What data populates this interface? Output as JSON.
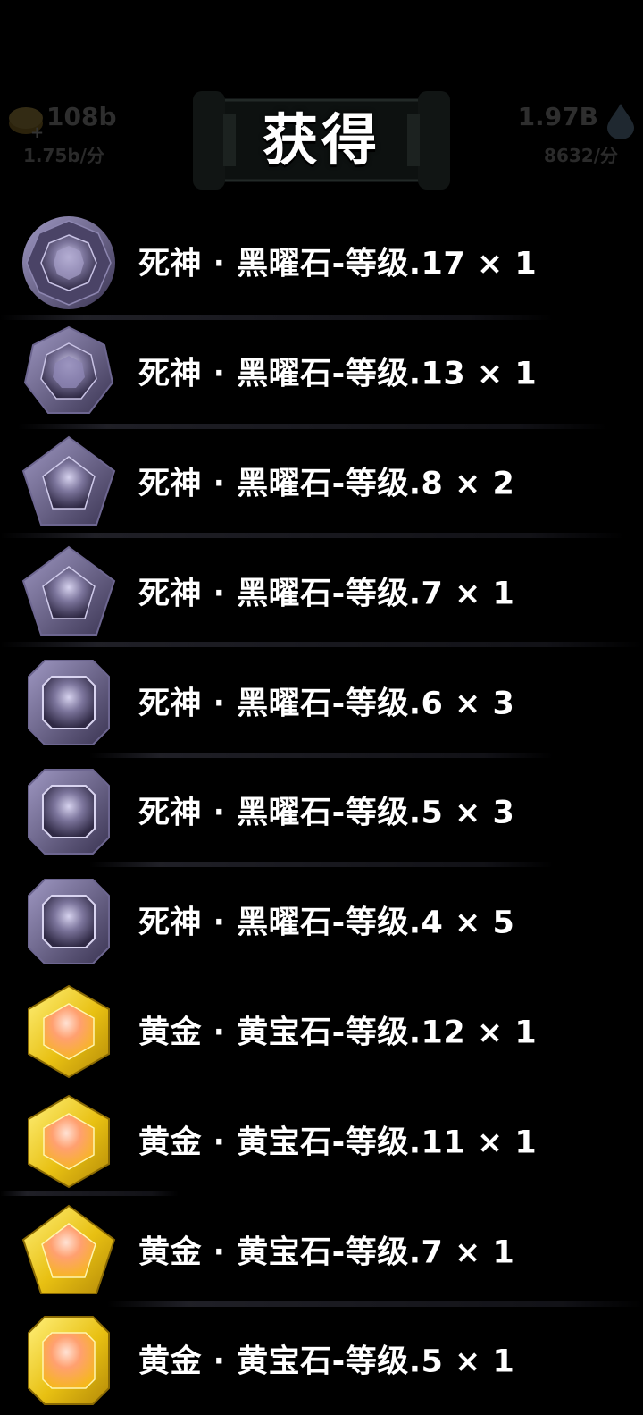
{
  "header": {
    "title": "获得",
    "left_resource": {
      "amount": "108b",
      "plus": "+",
      "rate": "1.75b/分",
      "icon": "gold-coin-icon"
    },
    "right_resource": {
      "amount": "1.97B",
      "rate": "8632/分",
      "icon": "water-drop-icon"
    }
  },
  "items": [
    {
      "name": "死神 · 黑曜石-等级.17 × 1",
      "gem": "obsidian-round-gem-icon"
    },
    {
      "name": "死神 · 黑曜石-等级.13 × 1",
      "gem": "obsidian-heptagon-gem-icon"
    },
    {
      "name": "死神 · 黑曜石-等级.8 × 2",
      "gem": "obsidian-pentagon-gem-icon"
    },
    {
      "name": "死神 · 黑曜石-等级.7 × 1",
      "gem": "obsidian-pentagon-gem-icon"
    },
    {
      "name": "死神 · 黑曜石-等级.6 × 3",
      "gem": "obsidian-square-gem-icon"
    },
    {
      "name": "死神 · 黑曜石-等级.5 × 3",
      "gem": "obsidian-square-gem-icon"
    },
    {
      "name": "死神 · 黑曜石-等级.4 × 5",
      "gem": "obsidian-square-gem-icon"
    },
    {
      "name": "黄金 · 黄宝石-等级.12 × 1",
      "gem": "topaz-hexagon-gem-icon"
    },
    {
      "name": "黄金 · 黄宝石-等级.11 × 1",
      "gem": "topaz-hexagon-gem-icon"
    },
    {
      "name": "黄金 · 黄宝石-等级.7 × 1",
      "gem": "topaz-pentagon-gem-icon"
    },
    {
      "name": "黄金 · 黄宝石-等级.5 × 1",
      "gem": "topaz-square-gem-icon"
    }
  ],
  "colors": {
    "background": "#000000",
    "text": "#ffffff",
    "obsidian_dark": "#3a3450",
    "obsidian_light": "#b8b2d6",
    "topaz_gold": "#f2d21a",
    "topaz_core": "#ff9a6a"
  }
}
